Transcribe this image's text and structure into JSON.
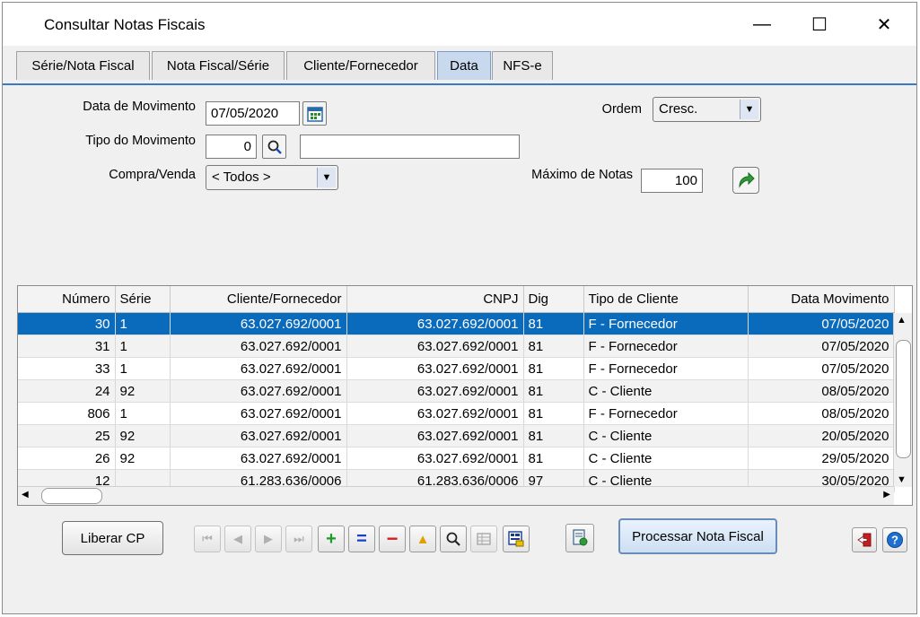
{
  "window": {
    "title": "Consultar Notas Fiscais",
    "minimize_glyph": "—",
    "maximize_glyph": "☐",
    "close_glyph": "✕"
  },
  "tabs": [
    {
      "label": "Série/Nota Fiscal"
    },
    {
      "label": "Nota Fiscal/Série"
    },
    {
      "label": "Cliente/Fornecedor"
    },
    {
      "label": "Data",
      "active": true
    },
    {
      "label": "NFS-e"
    }
  ],
  "form": {
    "data_movimento_label": "Data de Movimento",
    "data_movimento_value": "07/05/2020",
    "tipo_movimento_label": "Tipo do Movimento",
    "tipo_movimento_value": "0",
    "tipo_movimento_desc": "",
    "compra_venda_label": "Compra/Venda",
    "compra_venda_value": "< Todos >",
    "ordem_label": "Ordem",
    "ordem_value": "Cresc.",
    "maximo_label": "Máximo de Notas",
    "maximo_value": "100"
  },
  "table": {
    "columns": [
      "Número",
      "Série",
      "Cliente/Fornecedor",
      "CNPJ",
      "Dig",
      "Tipo de Cliente",
      "Data Movimento"
    ],
    "rows": [
      [
        "30",
        "1",
        "63.027.692/0001",
        "63.027.692/0001",
        "81",
        "F - Fornecedor",
        "07/05/2020"
      ],
      [
        "31",
        "1",
        "63.027.692/0001",
        "63.027.692/0001",
        "81",
        "F - Fornecedor",
        "07/05/2020"
      ],
      [
        "33",
        "1",
        "63.027.692/0001",
        "63.027.692/0001",
        "81",
        "F - Fornecedor",
        "07/05/2020"
      ],
      [
        "24",
        "92",
        "63.027.692/0001",
        "63.027.692/0001",
        "81",
        "C - Cliente",
        "08/05/2020"
      ],
      [
        "806",
        "1",
        "63.027.692/0001",
        "63.027.692/0001",
        "81",
        "F - Fornecedor",
        "08/05/2020"
      ],
      [
        "25",
        "92",
        "63.027.692/0001",
        "63.027.692/0001",
        "81",
        "C - Cliente",
        "20/05/2020"
      ],
      [
        "26",
        "92",
        "63.027.692/0001",
        "63.027.692/0001",
        "81",
        "C - Cliente",
        "29/05/2020"
      ],
      [
        "12",
        "",
        "61.283.636/0006",
        "61.283.636/0006",
        "97",
        "C - Cliente",
        "30/05/2020"
      ]
    ]
  },
  "buttons": {
    "liberar_cp": "Liberar CP",
    "processar": "Processar Nota Fiscal"
  },
  "colors": {
    "selection": "#0a6bbd",
    "tab_active": "#c8d9ee",
    "accent": "#3c79c5"
  },
  "icons": [
    "calendar-icon",
    "search-icon",
    "go-arrow-icon",
    "first-icon",
    "prev-icon",
    "next-icon",
    "last-icon",
    "add-icon",
    "equal-icon",
    "remove-icon",
    "up-icon",
    "zoom-icon",
    "grid-icon",
    "report-icon",
    "settings-doc-icon",
    "exit-icon",
    "help-icon"
  ]
}
